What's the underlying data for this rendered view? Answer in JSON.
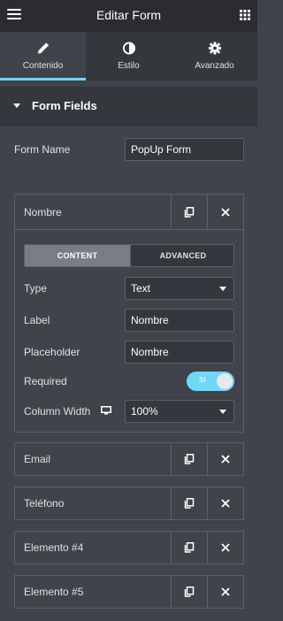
{
  "header": {
    "title": "Editar Form"
  },
  "tabs": [
    {
      "label": "Contenido",
      "icon": "pencil-icon",
      "active": true
    },
    {
      "label": "Estilo",
      "icon": "half-circle-icon",
      "active": false
    },
    {
      "label": "Avanzado",
      "icon": "gear-icon",
      "active": false
    }
  ],
  "section": {
    "title": "Form Fields"
  },
  "form_name": {
    "label": "Form Name",
    "value": "PopUp Form"
  },
  "expanded_item": {
    "title": "Nombre",
    "segment": {
      "content": "CONTENT",
      "advanced": "ADVANCED",
      "selected": "CONTENT"
    },
    "type": {
      "label": "Type",
      "value": "Text"
    },
    "field_label": {
      "label": "Label",
      "value": "Nombre"
    },
    "placeholder": {
      "label": "Placeholder",
      "value": "Nombre"
    },
    "required": {
      "label": "Required",
      "toggle_text": "SI",
      "on": true
    },
    "column_width": {
      "label": "Column Width",
      "icon": "desktop-icon",
      "value": "100%"
    }
  },
  "items": [
    {
      "title": "Email"
    },
    {
      "title": "Teléfono"
    },
    {
      "title": "Elemento #4"
    },
    {
      "title": "Elemento #5"
    }
  ],
  "colors": {
    "accent": "#71d7f7",
    "panel": "#404349",
    "header": "#2b2c31"
  }
}
